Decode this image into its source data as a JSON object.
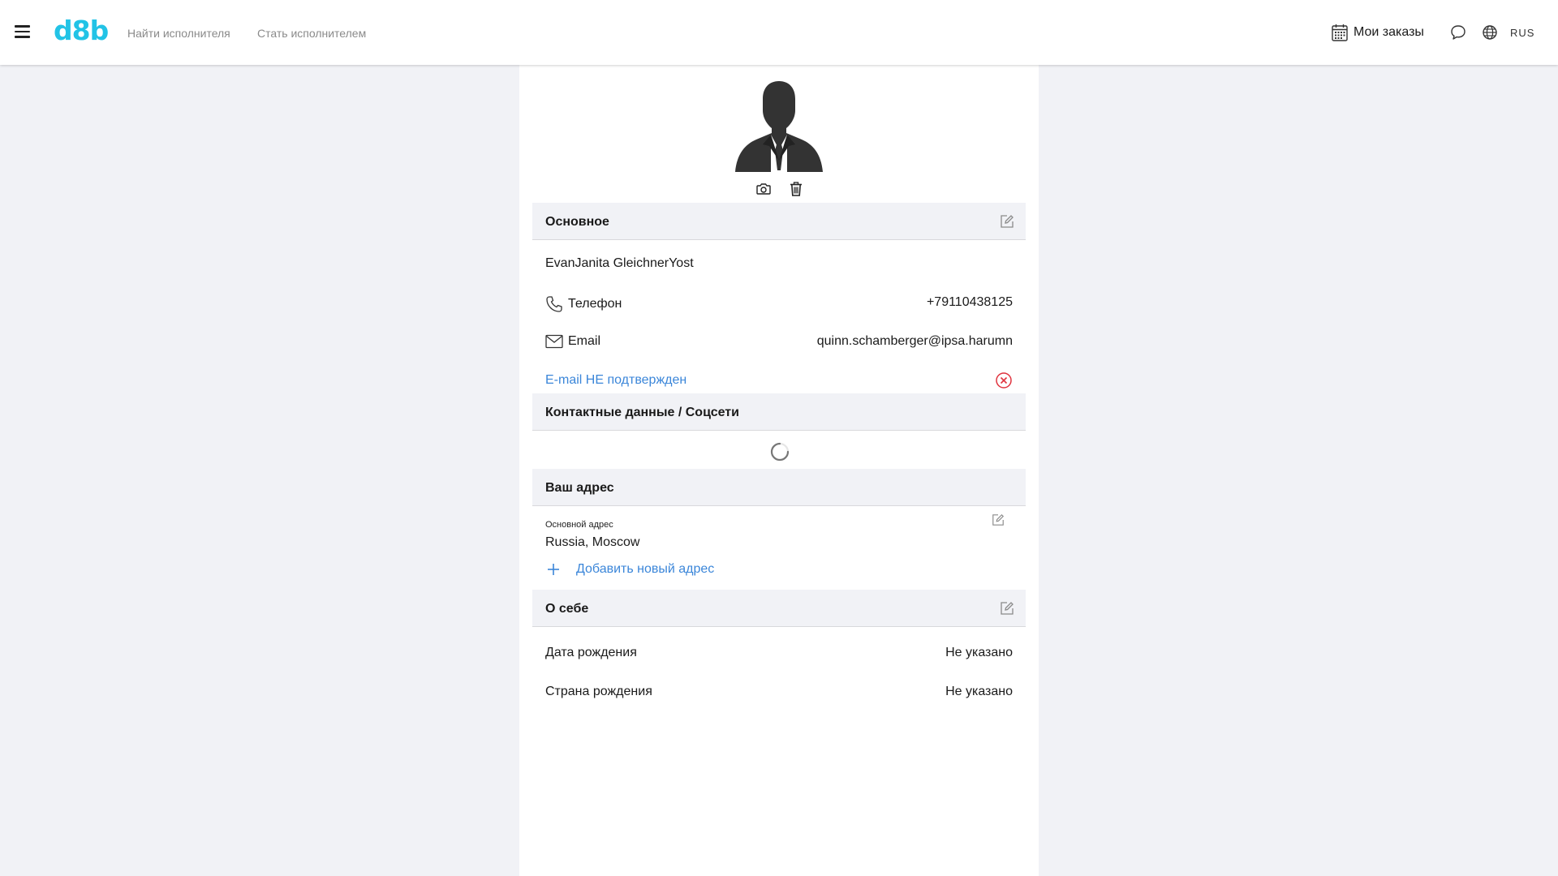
{
  "header": {
    "logo": "d8b",
    "nav": {
      "find_performer": "Найти исполнителя",
      "become_performer": "Стать исполнителем"
    },
    "orders_label": "Мои заказы",
    "language": "RUS",
    "icons": [
      "menu-icon",
      "calendar-icon",
      "chat-icon",
      "globe-icon"
    ]
  },
  "profile": {
    "avatar_icons": [
      "camera-icon",
      "trash-icon"
    ],
    "basic": {
      "title": "Основное",
      "name": "EvanJanita GleichnerYost",
      "phone_label": "Телефон",
      "phone_value": "+79110438125",
      "email_label": "Email",
      "email_value": "quinn.schamberger@ipsa.harumn",
      "email_status": "E-mail НЕ подтвержден"
    },
    "contacts": {
      "title": "Контактные данные / Соцсети"
    },
    "address": {
      "title": "Ваш адрес",
      "main_label": "Основной адрес",
      "main_value": "Russia, Moscow",
      "add_label": "Добавить новый адрес"
    },
    "about": {
      "title": "О себе",
      "birth_date_label": "Дата рождения",
      "birth_date_value": "Не указано",
      "birth_country_label": "Страна рождения",
      "birth_country_value": "Не указано"
    }
  },
  "colors": {
    "accent": "#22c3e6",
    "link": "#3b86d9",
    "error": "#e0343f",
    "section_bg": "#f1f2f6"
  }
}
